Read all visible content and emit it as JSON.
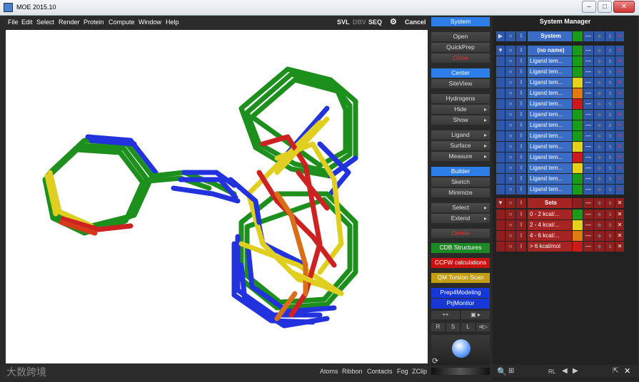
{
  "window": {
    "title": "MOE 2015.10"
  },
  "menu": {
    "items": [
      "File",
      "Edit",
      "Select",
      "Render",
      "Protein",
      "Compute",
      "Window",
      "Help"
    ],
    "right": {
      "svl": "SVL",
      "dbv": "DBV",
      "seq": "SEQ",
      "cancel": "Cancel"
    }
  },
  "mid": {
    "system_btn": "System",
    "open": "Open",
    "quickprep": "QuickPrep",
    "close": "Close",
    "center": "Center",
    "siteview": "SiteView",
    "hydrogens": "Hydrogens",
    "hide": "Hide",
    "show": "Show",
    "ligand": "Ligand",
    "surface": "Surface",
    "measure": "Measure",
    "builder": "Builder",
    "sketch": "Sketch",
    "minimize": "Minimize",
    "select": "Select",
    "extend": "Extend",
    "delete": "Delete",
    "cdb": "CDB Structures",
    "ccfw": "CCFW calculations",
    "qm": "QM Torsion Scan",
    "prep4": "Prep4Modeling",
    "prjmon": "PrjMonitor",
    "r": "R",
    "s": "S",
    "l": "L"
  },
  "sysmgr": {
    "title": "System Manager",
    "system_row": "System",
    "noname": "(no name)",
    "ligand_label": "Ligand tem...",
    "ligand_colors": [
      "#1a9c1a",
      "#1a9c1a",
      "#e3d21a",
      "#e07a12",
      "#cc1a1a",
      "#1a9c1a",
      "#1a9c1a",
      "#1a9c1a",
      "#e3d21a",
      "#cc1a1a",
      "#e3d21a",
      "#1a9c1a",
      "#1a9c1a"
    ],
    "sets_row": "Sets",
    "sets": [
      {
        "label": "0 - 2 kcal/...",
        "color": "#1a9c1a"
      },
      {
        "label": "2 - 4 kcal/...",
        "color": "#e3d21a"
      },
      {
        "label": "4 - 6 kcal/...",
        "color": "#e07a12"
      },
      {
        "label": "> 6 kcal/mol",
        "color": "#cc1a1a"
      }
    ],
    "footer": {
      "rl": "RL"
    }
  },
  "status": {
    "items": [
      "Atoms",
      "Ribbon",
      "Contacts",
      "Fog",
      "ZClip"
    ],
    "watermark": "大数跨境"
  }
}
